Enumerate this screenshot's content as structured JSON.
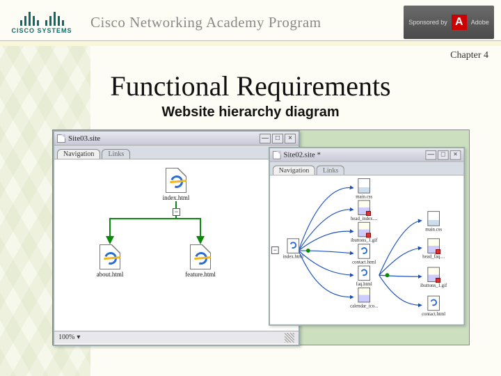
{
  "header": {
    "brand_top": "CISCO SYSTEMS",
    "program_title": "Cisco Networking Academy Program",
    "sponsor_label": "Sponsored by",
    "sponsor_name": "Adobe"
  },
  "chapter_label": "Chapter 4",
  "title": "Functional Requirements",
  "subtitle": "Website hierarchy diagram",
  "left_window": {
    "title": "Site03.site",
    "tabs": {
      "active": "Navigation",
      "inactive": "Links"
    },
    "root": "index.html",
    "children": [
      "about.html",
      "feature.html"
    ],
    "zoom": "100%"
  },
  "right_window": {
    "title": "Site02.site *",
    "tabs": {
      "active": "Navigation",
      "inactive": "Links"
    },
    "root": "index.html",
    "col1": [
      "main.css",
      "head_index....",
      "ibuttons_1.gif",
      "contact.html",
      "faq.html",
      "calendar_ico..."
    ],
    "col2": [
      "main.css",
      "head_faq....",
      "ibuttons_1.gif",
      "contact.html"
    ]
  }
}
